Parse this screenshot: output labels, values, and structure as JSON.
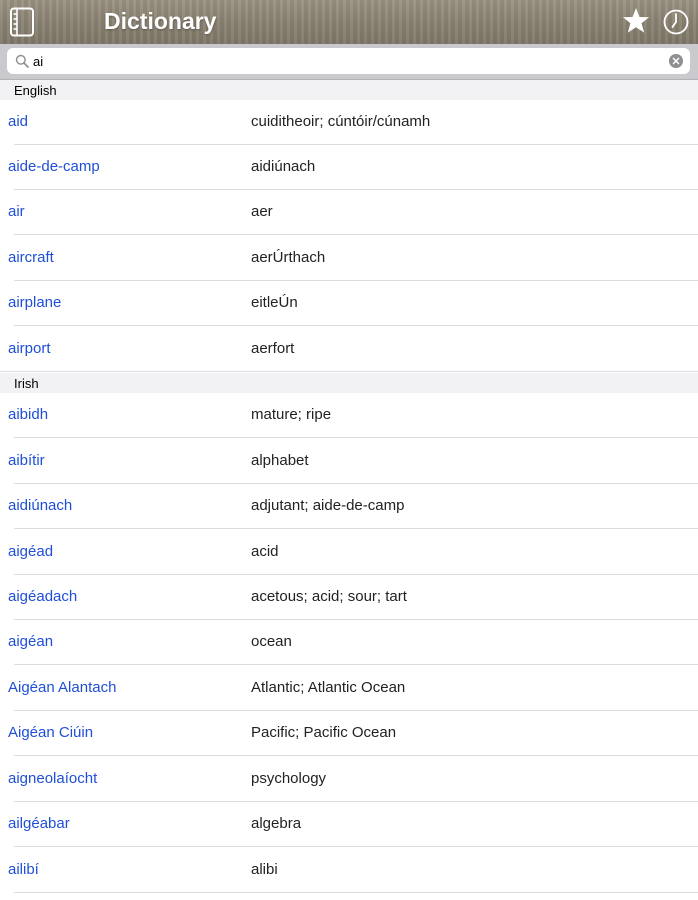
{
  "header": {
    "title": "Dictionary",
    "icons": {
      "left": "book-icon",
      "favorites": "star-icon",
      "history": "clock-icon"
    },
    "colors": {
      "link": "#1f4fd8",
      "bar": "#8c8474"
    }
  },
  "search": {
    "value": "ai",
    "placeholder": "",
    "icon": "search-icon",
    "clear_icon": "clear-icon"
  },
  "sections": [
    {
      "label": "English",
      "entries": [
        {
          "word": "aid",
          "translation": "cuiditheoir; cúntóir/cúnamh"
        },
        {
          "word": "aide-de-camp",
          "translation": "aidiúnach"
        },
        {
          "word": "air",
          "translation": "aer"
        },
        {
          "word": "aircraft",
          "translation": "aerÚrthach"
        },
        {
          "word": "airplane",
          "translation": "eitleÚn"
        },
        {
          "word": "airport",
          "translation": "aerfort"
        }
      ]
    },
    {
      "label": "Irish",
      "entries": [
        {
          "word": "aibidh",
          "translation": "mature; ripe"
        },
        {
          "word": "aibítir",
          "translation": "alphabet"
        },
        {
          "word": "aidiúnach",
          "translation": "adjutant; aide-de-camp"
        },
        {
          "word": "aigéad",
          "translation": "acid"
        },
        {
          "word": "aigéadach",
          "translation": "acetous; acid; sour; tart"
        },
        {
          "word": "aigéan",
          "translation": "ocean"
        },
        {
          "word": "Aigéan Alantach",
          "translation": "Atlantic; Atlantic Ocean"
        },
        {
          "word": "Aigéan Ciúin",
          "translation": "Pacific; Pacific Ocean"
        },
        {
          "word": "aigneolaíocht",
          "translation": "psychology"
        },
        {
          "word": "ailgéabar",
          "translation": "algebra"
        },
        {
          "word": "ailibí",
          "translation": "alibi"
        }
      ]
    }
  ]
}
